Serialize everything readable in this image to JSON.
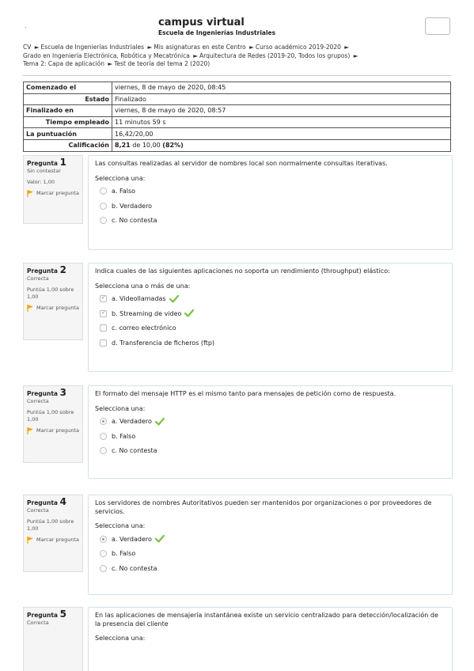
{
  "header": {
    "dot": ".",
    "title": "campus virtual",
    "subtitle": "Escuela de Ingenierías Industriales"
  },
  "breadcrumb": {
    "line1": [
      "CV",
      "Escuela de Ingenierías Industriales",
      "Mis asignaturas en este Centro",
      "Curso académico 2019-2020",
      ""
    ],
    "line2": [
      "Grado en Ingeniería Electrónica, Robótica y Mecatrónica",
      "Arquitectura de Redes (2019-20, Todos los grupos)",
      ""
    ],
    "line3": [
      "Tema 2: Capa de aplicación",
      "Test de teoría del tema 2 (2020)"
    ]
  },
  "summary": {
    "started_label": "Comenzado el",
    "started_value": "viernes, 8 de mayo de 2020, 08:45",
    "state_label": "Estado",
    "state_value": "Finalizado",
    "finished_label": "Finalizado en",
    "finished_value": "viernes, 8 de mayo de 2020, 08:57",
    "time_label": "Tiempo empleado",
    "time_value": "11 minutos 59 s",
    "points_label": "La puntuación",
    "points_value": "16,42/20,00",
    "grade_label": "Calificación",
    "grade_value": "8,21",
    "grade_of": "de 10,00",
    "grade_pct": "82%"
  },
  "questions": [
    {
      "word": "Pregunta",
      "number": "1",
      "status": "Sin contestar",
      "mark": "Valor: 1,00",
      "flag": "Marcar pregunta",
      "text": "Las consultas realizadas al servidor de nombres local son normalmente consultas iterativas.",
      "prompt": "Selecciona una:",
      "answers": [
        "a. Falso",
        "b. Verdadero",
        "c. No contesta"
      ]
    },
    {
      "word": "Pregunta",
      "number": "2",
      "status": "Correcta",
      "mark": "Puntúa 1,00 sobre 1,00",
      "flag": "Marcar pregunta",
      "text": "Indica cuales de las siguientes aplicaciones no soporta un rendimiento (throughput) elástico:",
      "prompt": "Selecciona una o más de una:",
      "answers": [
        "a. Videollamadas",
        "b. Streaming de video",
        "c. correo electrónico",
        "d. Transferencia de ficheros (ftp)"
      ]
    },
    {
      "word": "Pregunta",
      "number": "3",
      "status": "Correcta",
      "mark": "Puntúa 1,00 sobre 1,00",
      "flag": "Marcar pregunta",
      "text": "El formato del mensaje HTTP es el mismo tanto para mensajes de petición como de respuesta.",
      "prompt": "Selecciona una:",
      "answers": [
        "a. Verdadero",
        "b. Falso",
        "c. No contesta"
      ]
    },
    {
      "word": "Pregunta",
      "number": "4",
      "status": "Correcta",
      "mark": "Puntúa 1,00 sobre 1,00",
      "flag": "Marcar pregunta",
      "text": "Los servidores de nombres Autoritativos pueden ser mantenidos por organizaciones o por proveedores de servicios.",
      "prompt": "Selecciona una:",
      "answers": [
        "a. Verdadero",
        "b. Falso",
        "c. No contesta"
      ]
    },
    {
      "word": "Pregunta",
      "number": "5",
      "status": "Correcta",
      "text": "En las aplicaciones de mensajería instantánea existe un servicio centralizado para detección/localización de la presencia del cliente",
      "prompt": "Selecciona una:"
    }
  ],
  "colors": {
    "check": "#7ac143",
    "flag": "#f0a500",
    "box_border": "#cfe3ee"
  }
}
